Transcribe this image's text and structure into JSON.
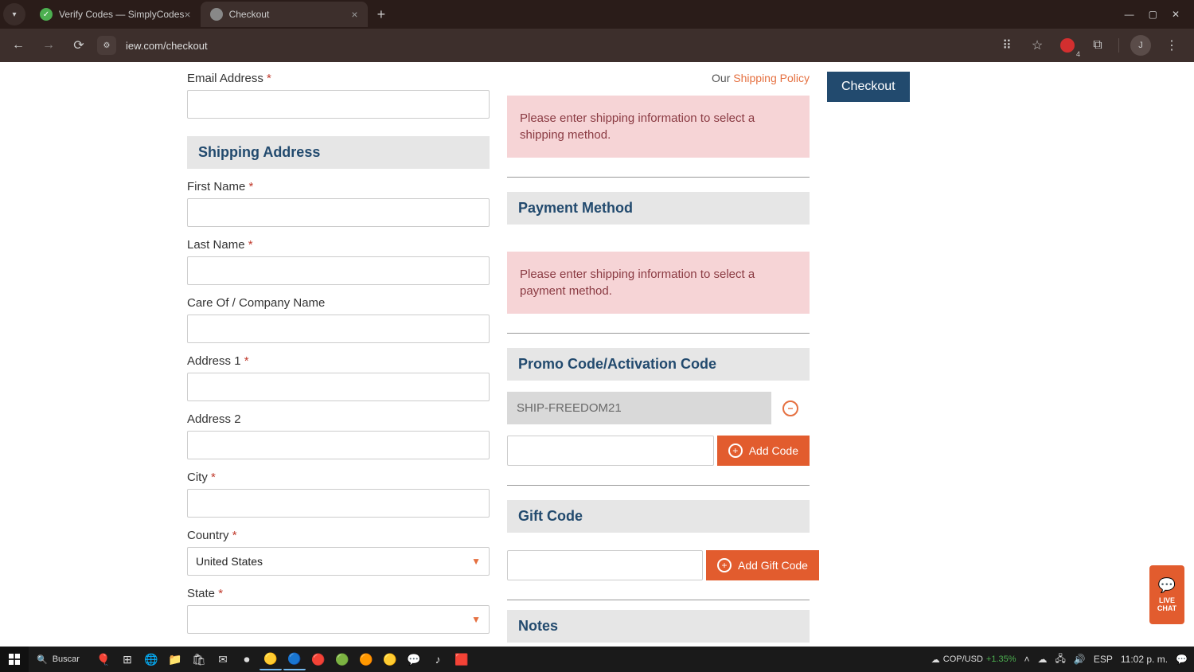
{
  "browser": {
    "tabs": [
      {
        "title": "Verify Codes — SimplyCodes",
        "active": false
      },
      {
        "title": "Checkout",
        "active": true
      }
    ],
    "url": "iew.com/checkout",
    "ext_count": "4",
    "profile_initial": "J"
  },
  "page": {
    "email_label": "Email Address",
    "shipping_header": "Shipping Address",
    "first_name_label": "First Name",
    "last_name_label": "Last Name",
    "care_of_label": "Care Of / Company Name",
    "address1_label": "Address 1",
    "address2_label": "Address 2",
    "city_label": "City",
    "country_label": "Country",
    "country_value": "United States",
    "state_label": "State",
    "state_value": "",
    "policy_prefix": "Our ",
    "policy_link": "Shipping Policy",
    "alert_shipping": "Please enter shipping information to select a shipping method.",
    "payment_header": "Payment Method",
    "alert_payment": "Please enter shipping information to select a payment method.",
    "promo_header": "Promo Code/Activation Code",
    "promo_applied": "SHIP-FREEDOM21",
    "add_code_label": "Add Code",
    "gift_header": "Gift Code",
    "add_gift_label": "Add Gift Code",
    "notes_header": "Notes",
    "checkout_btn": "Checkout"
  },
  "live_chat": {
    "line1": "LIVE",
    "line2": "CHAT"
  },
  "taskbar": {
    "search_label": "Buscar",
    "ticker_pair": "COP/USD",
    "ticker_pct": "+1.35%",
    "lang": "ESP",
    "time": "11:02 p. m."
  }
}
